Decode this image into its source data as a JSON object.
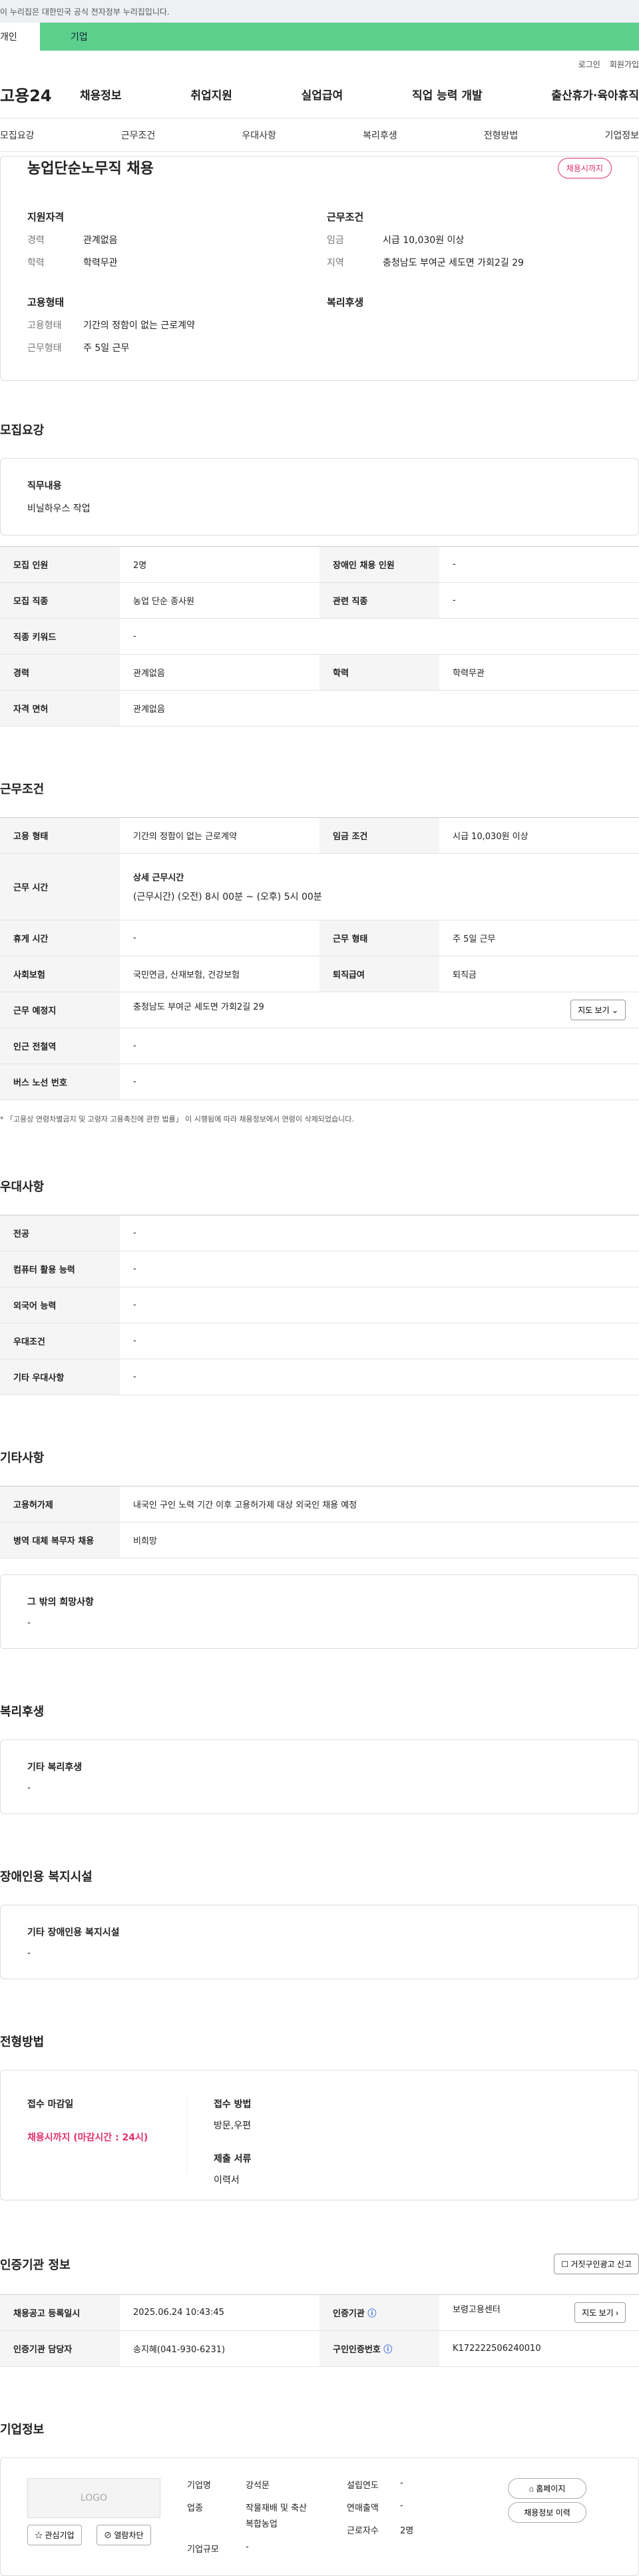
{
  "topbar": {
    "notice": "이 누리집은 대한민국 공식 전자정부 누리집입니다."
  },
  "tabs": {
    "personal": "개인",
    "business": "기업"
  },
  "util": {
    "login": "로그인",
    "signup": "회원가입"
  },
  "gnb": {
    "logo": "고용24",
    "menu": [
      "채용정보",
      "취업지원",
      "실업급여",
      "직업 능력 개발",
      "출산휴가·육아휴직"
    ]
  },
  "subnav": [
    "모집요강",
    "근무조건",
    "우대사항",
    "복리후생",
    "전형방법",
    "기업정보"
  ],
  "summary": {
    "title": "농업단순노무직 채용",
    "badge": "채용시까지",
    "qual_title": "지원자격",
    "career_k": "경력",
    "career_v": "관계없음",
    "edu_k": "학력",
    "edu_v": "학력무관",
    "cond_title": "근무조건",
    "wage_k": "임금",
    "wage_v": "시급 10,030원 이상",
    "region_k": "지역",
    "region_v": "충청남도 부여군 세도면 가회2길 29",
    "emp_title": "고용형태",
    "emptype_k": "고용형태",
    "emptype_v": "기간의 정함이 없는 근로계약",
    "worktype_k": "근무형태",
    "worktype_v": "주 5일 근무",
    "welfare_title": "복리후생"
  },
  "recruit": {
    "heading": "모집요강",
    "duty_title": "직무내용",
    "duty_value": "비닐하우스 작업",
    "rows": [
      [
        "모집 인원",
        "2명",
        "장애인 채용 인원",
        "-"
      ],
      [
        "모집 직종",
        "농업 단순 종사원",
        "관련 직종",
        "-"
      ],
      [
        "직종 키워드",
        "-",
        "",
        ""
      ],
      [
        "경력",
        "관계없음",
        "학력",
        "학력무관"
      ],
      [
        "자격 면허",
        "관계없음",
        "",
        ""
      ]
    ]
  },
  "work": {
    "heading": "근무조건",
    "r1": [
      "고용 형태",
      "기간의 정함이 없는 근로계약",
      "임금 조건",
      "시급 10,030원 이상"
    ],
    "hours_h": "근무 시간",
    "hours_title": "상세 근무시간",
    "hours_value": "(근무시간) (오전) 8시 00분 ~ (오후) 5시 00분",
    "r3": [
      "휴게 시간",
      "-",
      "근무 형태",
      "주 5일 근무"
    ],
    "r4": [
      "사회보험",
      "국민연금, 산재보험, 건강보험",
      "퇴직급여",
      "퇴직금"
    ],
    "loc_h": "근무 예정지",
    "loc_v": "충청남도 부여군 세도면 가회2길 29",
    "map_btn": "지도 보기",
    "r6": [
      "인근 전철역",
      "-"
    ],
    "r7": [
      "버스 노선 번호",
      "-"
    ],
    "note": "* 「고용상 연령차별금지 및 고령자 고용촉진에 관한 법률」 이 시행됨에 따라 채용정보에서 연령이 삭제되었습니다."
  },
  "pref": {
    "heading": "우대사항",
    "rows": [
      [
        "전공",
        "-"
      ],
      [
        "컴퓨터 활용 능력",
        "-"
      ],
      [
        "외국어 능력",
        "-"
      ],
      [
        "우대조건",
        "-"
      ],
      [
        "기타 우대사항",
        "-"
      ]
    ]
  },
  "etc": {
    "heading": "기타사항",
    "rows": [
      [
        "고용허가제",
        "내국인 구인 노력 기간 이후 고용허가제 대상 외국인 채용 예정"
      ],
      [
        "병역 대체 복무자 채용",
        "비희망"
      ]
    ],
    "wish_title": "그 밖의 희망사항",
    "wish_value": "-"
  },
  "welfare": {
    "heading": "복리후생",
    "title": "기타 복리후생",
    "value": "-"
  },
  "disability": {
    "heading": "장애인용 복지시설",
    "title": "기타 장애인용 복지시설",
    "value": "-"
  },
  "process": {
    "heading": "전형방법",
    "deadline_title": "접수 마감일",
    "deadline_value": "채용시까지 (마감시간 : 24시)",
    "method_title": "접수 방법",
    "method_value": "방문,우편",
    "docs_title": "제출 서류",
    "docs_value": "이력서"
  },
  "cert": {
    "heading": "인증기관 정보",
    "report_btn": "거짓구인광고 신고",
    "r1": [
      "채용공고 등록일시",
      "2025.06.24 10:43:45",
      "인증기관",
      "보령고용센터"
    ],
    "r2": [
      "인증기관 담당자",
      "송지혜(041-930-6231)",
      "구인인증번호",
      "K172222506240010"
    ],
    "map_btn": "지도 보기"
  },
  "company": {
    "heading": "기업정보",
    "logo": "LOGO",
    "interest_btn": "관심기업",
    "block_btn": "열람차단",
    "name_k": "기업명",
    "name_v": "강석문",
    "industry_k": "업종",
    "industry_v1": "작물재배 및 축산",
    "industry_v2": "복합농업",
    "size_k": "기업규모",
    "size_v": "-",
    "founded_k": "설립연도",
    "founded_v": "-",
    "sales_k": "연매출액",
    "sales_v": "-",
    "staff_k": "근로자수",
    "staff_v": "2명",
    "home_btn": "홈페이지",
    "history_btn": "채용정보 이력"
  }
}
